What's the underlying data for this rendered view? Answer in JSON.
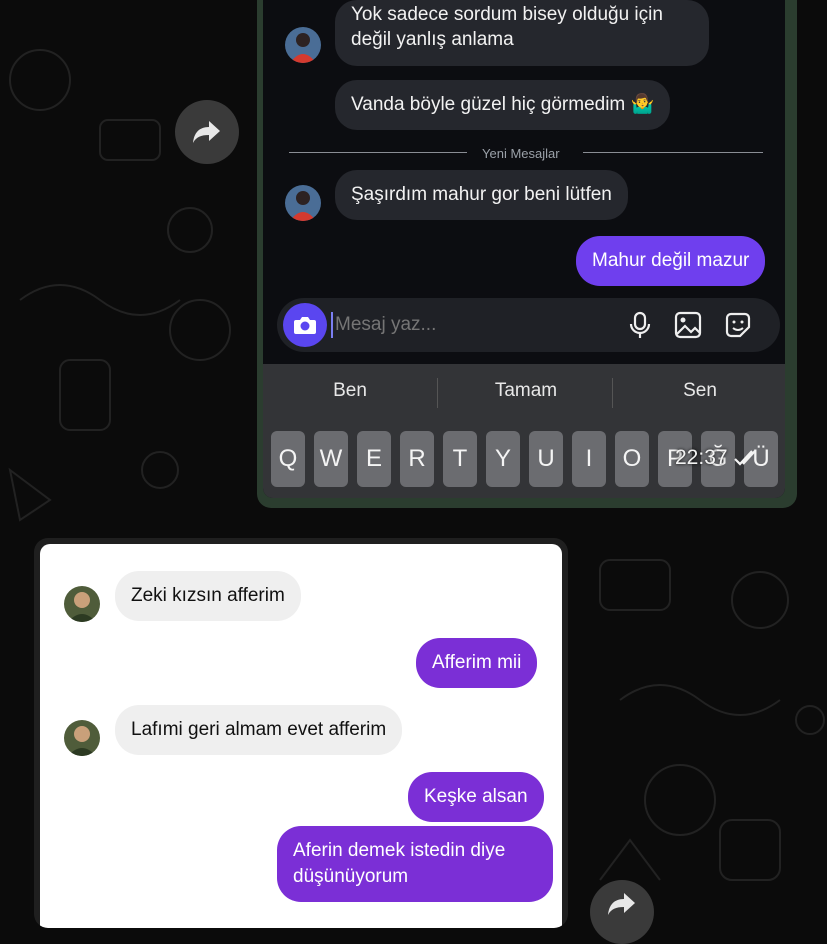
{
  "colors": {
    "accent_purple": "#6f3fee",
    "bubble_purple_light": "#7b2fd6",
    "dark_bg": "#0c0d11"
  },
  "top_chat": {
    "messages": [
      {
        "from": "them",
        "text_line1": "Yok sadece sordum bisey olduğu için",
        "text_line2": "değil yanlış anlama"
      },
      {
        "from": "them",
        "text": "Vanda böyle güzel hiç görmedim 🤷‍♂️"
      },
      {
        "from": "them",
        "text": "Şaşırdım mahur gor beni lütfen"
      },
      {
        "from": "me",
        "text": "Mahur değil mazur"
      }
    ],
    "divider": "Yeni Mesajlar",
    "composer": {
      "placeholder": "Mesaj yaz..."
    },
    "suggestions": [
      "Ben",
      "Tamam",
      "Sen"
    ],
    "keys": [
      "Q",
      "W",
      "E",
      "R",
      "T",
      "Y",
      "U",
      "I",
      "O",
      "P",
      "Ğ",
      "Ü"
    ],
    "time": "22:37"
  },
  "bottom_chat": {
    "messages": [
      {
        "from": "them",
        "text": "Zeki kızsın afferim"
      },
      {
        "from": "me",
        "text": "Afferim mii"
      },
      {
        "from": "them",
        "text": "Lafımi geri almam evet afferim"
      },
      {
        "from": "me",
        "text": "Keşke alsan"
      },
      {
        "from": "me",
        "text_line1": "Aferin demek istedin diye",
        "text_line2": "düşünüyorum"
      }
    ]
  }
}
